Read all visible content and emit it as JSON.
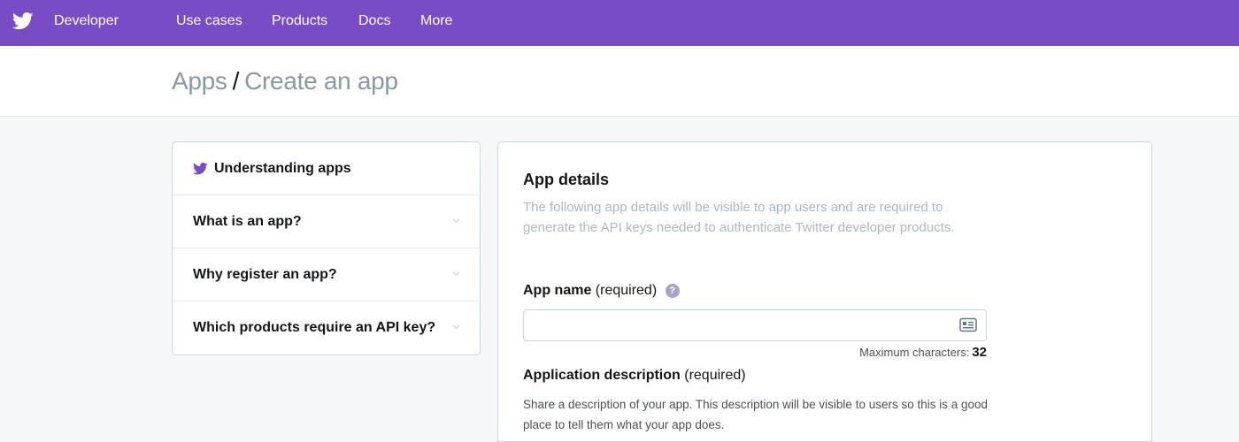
{
  "nav": {
    "brand": "Developer",
    "links": [
      "Use cases",
      "Products",
      "Docs",
      "More"
    ]
  },
  "breadcrumb": {
    "parent": "Apps",
    "separator": "/",
    "current": "Create an app"
  },
  "sidebar": {
    "title": "Understanding apps",
    "items": [
      {
        "label": "What is an app?"
      },
      {
        "label": "Why register an app?"
      },
      {
        "label": "Which products require an API key?"
      }
    ]
  },
  "form": {
    "section_title": "App details",
    "section_description": "The following app details will be visible to app users and are required to generate the API keys needed to authenticate Twitter developer products.",
    "app_name": {
      "label": "App name",
      "qualifier": "(required)",
      "help": "?",
      "value": "",
      "max_label": "Maximum characters:",
      "max_value": "32"
    },
    "app_description": {
      "label": "Application description",
      "qualifier": "(required)",
      "help_text": "Share a description of your app. This description will be visible to users so this is a good place to tell them what your app does."
    }
  },
  "colors": {
    "brand_purple": "#794bc4",
    "muted_text": "#aab8c2"
  }
}
